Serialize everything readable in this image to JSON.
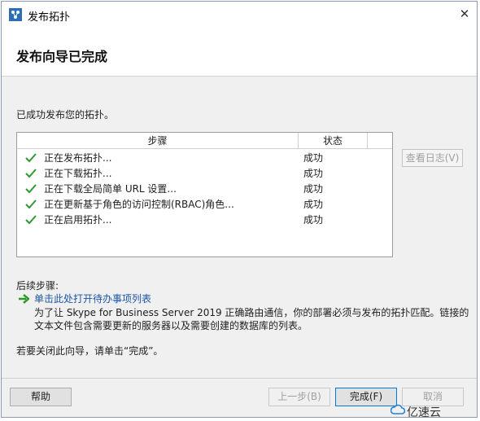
{
  "window": {
    "title": "发布拓扑",
    "close_glyph": "✕"
  },
  "header": {
    "title": "发布向导已完成"
  },
  "main": {
    "success_message": "已成功发布您的拓扑。",
    "table": {
      "headers": [
        "步骤",
        "状态"
      ],
      "rows": [
        {
          "step": "正在发布拓扑...",
          "status": "成功",
          "icon": "checkmark-icon"
        },
        {
          "step": "正在下载拓扑...",
          "status": "成功",
          "icon": "checkmark-icon"
        },
        {
          "step": "正在下载全局简单 URL 设置...",
          "status": "成功",
          "icon": "checkmark-icon"
        },
        {
          "step": "正在更新基于角色的访问控制(RBAC)角色...",
          "status": "成功",
          "icon": "checkmark-icon"
        },
        {
          "step": "正在启用拓扑...",
          "status": "成功",
          "icon": "checkmark-icon"
        }
      ]
    },
    "view_log_label": "查看日志(V)",
    "next_steps_label": "后续步骤:",
    "todo_link": "单击此处打开待办事项列表",
    "todo_description": "为了让 Skype for Business Server 2019 正确路由通信，你的部署必须与发布的拓扑匹配。链接的文本文件包含需要更新的服务器以及需要创建的数据库的列表。",
    "close_hint": "若要关闭此向导，请单击“完成”。"
  },
  "footer": {
    "help_label": "帮助",
    "back_label": "上一步(B)",
    "finish_label": "完成(F)",
    "cancel_label": "取消"
  },
  "watermark": {
    "text": "亿速云"
  },
  "colors": {
    "check": "#2e9a2e",
    "link": "#1a55a6",
    "accent": "#0078d7"
  }
}
